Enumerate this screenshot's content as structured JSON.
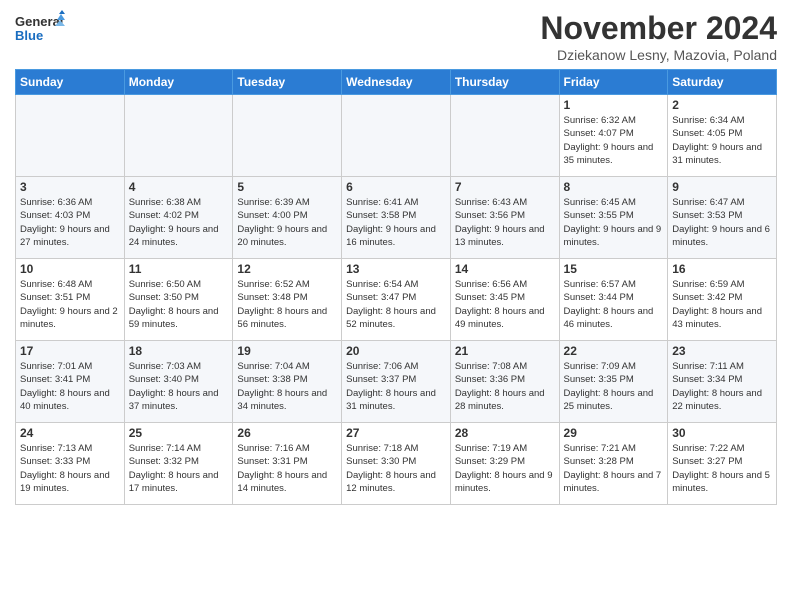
{
  "header": {
    "logo_line1": "General",
    "logo_line2": "Blue",
    "month_title": "November 2024",
    "subtitle": "Dziekanow Lesny, Mazovia, Poland"
  },
  "weekdays": [
    "Sunday",
    "Monday",
    "Tuesday",
    "Wednesday",
    "Thursday",
    "Friday",
    "Saturday"
  ],
  "weeks": [
    [
      {
        "day": "",
        "content": ""
      },
      {
        "day": "",
        "content": ""
      },
      {
        "day": "",
        "content": ""
      },
      {
        "day": "",
        "content": ""
      },
      {
        "day": "",
        "content": ""
      },
      {
        "day": "1",
        "content": "Sunrise: 6:32 AM\nSunset: 4:07 PM\nDaylight: 9 hours\nand 35 minutes."
      },
      {
        "day": "2",
        "content": "Sunrise: 6:34 AM\nSunset: 4:05 PM\nDaylight: 9 hours\nand 31 minutes."
      }
    ],
    [
      {
        "day": "3",
        "content": "Sunrise: 6:36 AM\nSunset: 4:03 PM\nDaylight: 9 hours\nand 27 minutes."
      },
      {
        "day": "4",
        "content": "Sunrise: 6:38 AM\nSunset: 4:02 PM\nDaylight: 9 hours\nand 24 minutes."
      },
      {
        "day": "5",
        "content": "Sunrise: 6:39 AM\nSunset: 4:00 PM\nDaylight: 9 hours\nand 20 minutes."
      },
      {
        "day": "6",
        "content": "Sunrise: 6:41 AM\nSunset: 3:58 PM\nDaylight: 9 hours\nand 16 minutes."
      },
      {
        "day": "7",
        "content": "Sunrise: 6:43 AM\nSunset: 3:56 PM\nDaylight: 9 hours\nand 13 minutes."
      },
      {
        "day": "8",
        "content": "Sunrise: 6:45 AM\nSunset: 3:55 PM\nDaylight: 9 hours\nand 9 minutes."
      },
      {
        "day": "9",
        "content": "Sunrise: 6:47 AM\nSunset: 3:53 PM\nDaylight: 9 hours\nand 6 minutes."
      }
    ],
    [
      {
        "day": "10",
        "content": "Sunrise: 6:48 AM\nSunset: 3:51 PM\nDaylight: 9 hours\nand 2 minutes."
      },
      {
        "day": "11",
        "content": "Sunrise: 6:50 AM\nSunset: 3:50 PM\nDaylight: 8 hours\nand 59 minutes."
      },
      {
        "day": "12",
        "content": "Sunrise: 6:52 AM\nSunset: 3:48 PM\nDaylight: 8 hours\nand 56 minutes."
      },
      {
        "day": "13",
        "content": "Sunrise: 6:54 AM\nSunset: 3:47 PM\nDaylight: 8 hours\nand 52 minutes."
      },
      {
        "day": "14",
        "content": "Sunrise: 6:56 AM\nSunset: 3:45 PM\nDaylight: 8 hours\nand 49 minutes."
      },
      {
        "day": "15",
        "content": "Sunrise: 6:57 AM\nSunset: 3:44 PM\nDaylight: 8 hours\nand 46 minutes."
      },
      {
        "day": "16",
        "content": "Sunrise: 6:59 AM\nSunset: 3:42 PM\nDaylight: 8 hours\nand 43 minutes."
      }
    ],
    [
      {
        "day": "17",
        "content": "Sunrise: 7:01 AM\nSunset: 3:41 PM\nDaylight: 8 hours\nand 40 minutes."
      },
      {
        "day": "18",
        "content": "Sunrise: 7:03 AM\nSunset: 3:40 PM\nDaylight: 8 hours\nand 37 minutes."
      },
      {
        "day": "19",
        "content": "Sunrise: 7:04 AM\nSunset: 3:38 PM\nDaylight: 8 hours\nand 34 minutes."
      },
      {
        "day": "20",
        "content": "Sunrise: 7:06 AM\nSunset: 3:37 PM\nDaylight: 8 hours\nand 31 minutes."
      },
      {
        "day": "21",
        "content": "Sunrise: 7:08 AM\nSunset: 3:36 PM\nDaylight: 8 hours\nand 28 minutes."
      },
      {
        "day": "22",
        "content": "Sunrise: 7:09 AM\nSunset: 3:35 PM\nDaylight: 8 hours\nand 25 minutes."
      },
      {
        "day": "23",
        "content": "Sunrise: 7:11 AM\nSunset: 3:34 PM\nDaylight: 8 hours\nand 22 minutes."
      }
    ],
    [
      {
        "day": "24",
        "content": "Sunrise: 7:13 AM\nSunset: 3:33 PM\nDaylight: 8 hours\nand 19 minutes."
      },
      {
        "day": "25",
        "content": "Sunrise: 7:14 AM\nSunset: 3:32 PM\nDaylight: 8 hours\nand 17 minutes."
      },
      {
        "day": "26",
        "content": "Sunrise: 7:16 AM\nSunset: 3:31 PM\nDaylight: 8 hours\nand 14 minutes."
      },
      {
        "day": "27",
        "content": "Sunrise: 7:18 AM\nSunset: 3:30 PM\nDaylight: 8 hours\nand 12 minutes."
      },
      {
        "day": "28",
        "content": "Sunrise: 7:19 AM\nSunset: 3:29 PM\nDaylight: 8 hours\nand 9 minutes."
      },
      {
        "day": "29",
        "content": "Sunrise: 7:21 AM\nSunset: 3:28 PM\nDaylight: 8 hours\nand 7 minutes."
      },
      {
        "day": "30",
        "content": "Sunrise: 7:22 AM\nSunset: 3:27 PM\nDaylight: 8 hours\nand 5 minutes."
      }
    ]
  ]
}
